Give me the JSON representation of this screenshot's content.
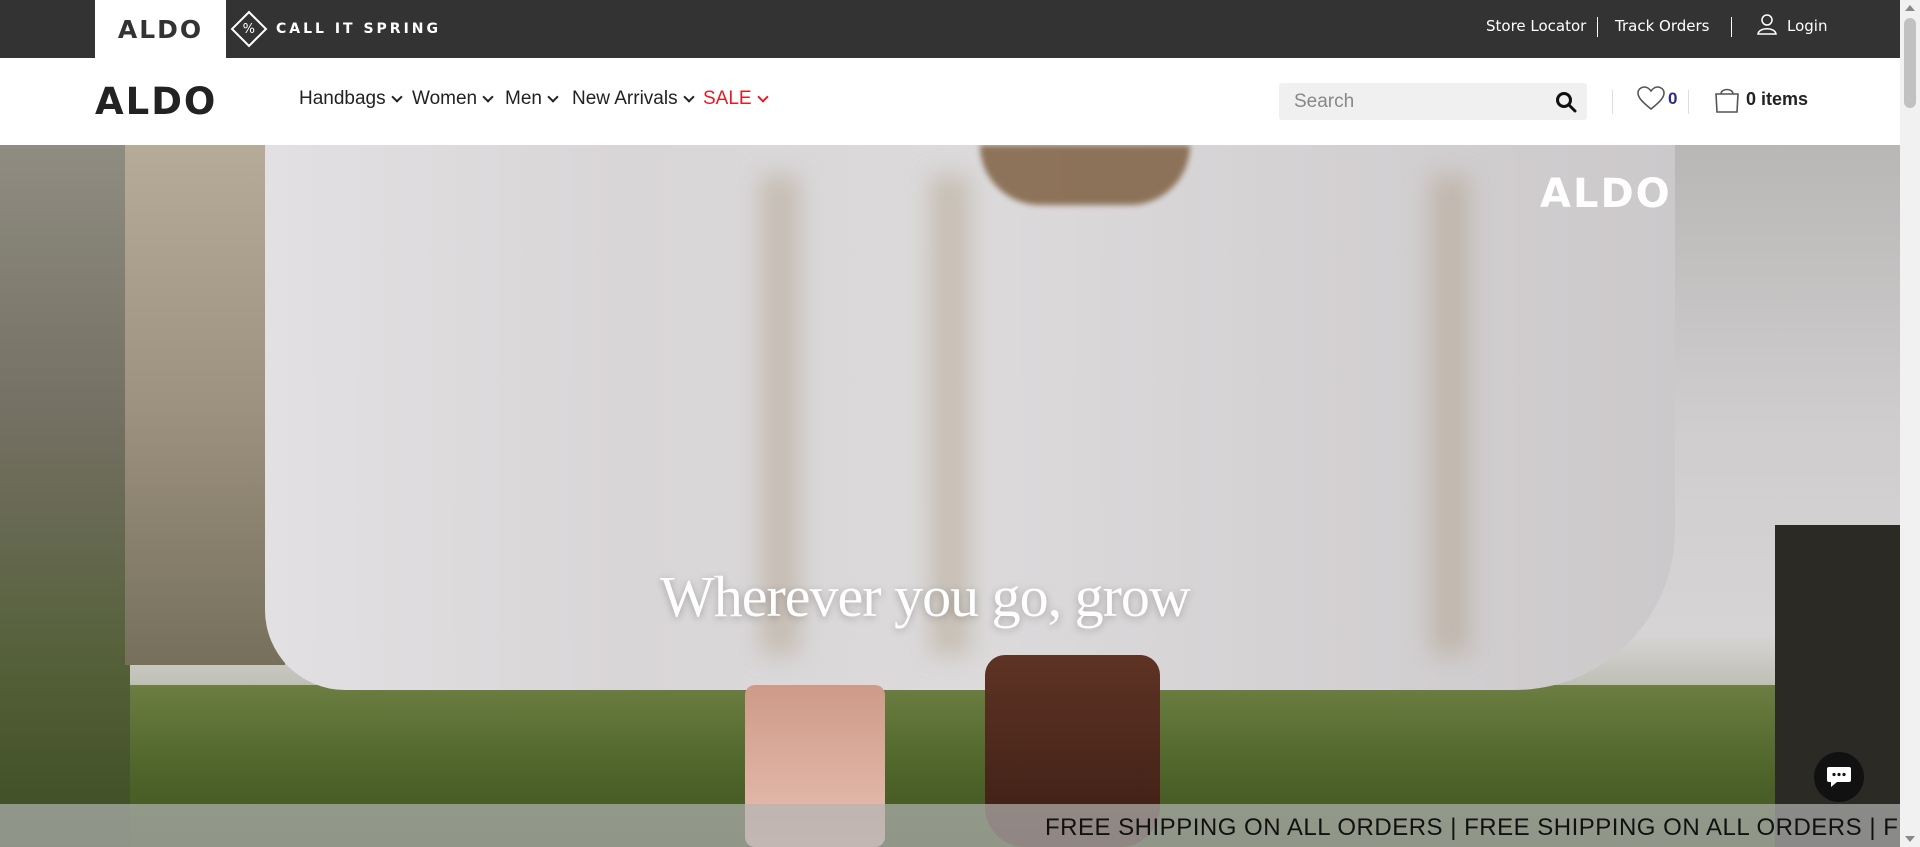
{
  "topbar": {
    "brand_logo": "ALDO",
    "spring_label": "CALL IT SPRING",
    "spring_icon": "cis",
    "store_locator": "Store Locator",
    "track_orders": "Track Orders",
    "login": "Login"
  },
  "nav": {
    "logo": "ALDO",
    "items": [
      {
        "label": "Handbags"
      },
      {
        "label": "Women"
      },
      {
        "label": "Men"
      },
      {
        "label": "New Arrivals"
      },
      {
        "label": "SALE"
      }
    ],
    "search_placeholder": "Search",
    "wishlist_count": "0",
    "cart_label": "0 items"
  },
  "hero": {
    "logo": "ALDO",
    "tagline": "Wherever you go, grow"
  },
  "promo": {
    "text": "FREE SHIPPING ON ALL ORDERS | FREE SHIPPING ON ALL ORDERS | FREE SHIPPIN"
  },
  "colors": {
    "topbar_bg": "#333333",
    "sale": "#e31c23",
    "wishlist_count": "#2d2a8c"
  },
  "icons": {
    "user": "user-icon",
    "search": "search-icon",
    "wishlist": "heart-icon",
    "cart": "bag-icon",
    "chat": "chat-icon"
  }
}
